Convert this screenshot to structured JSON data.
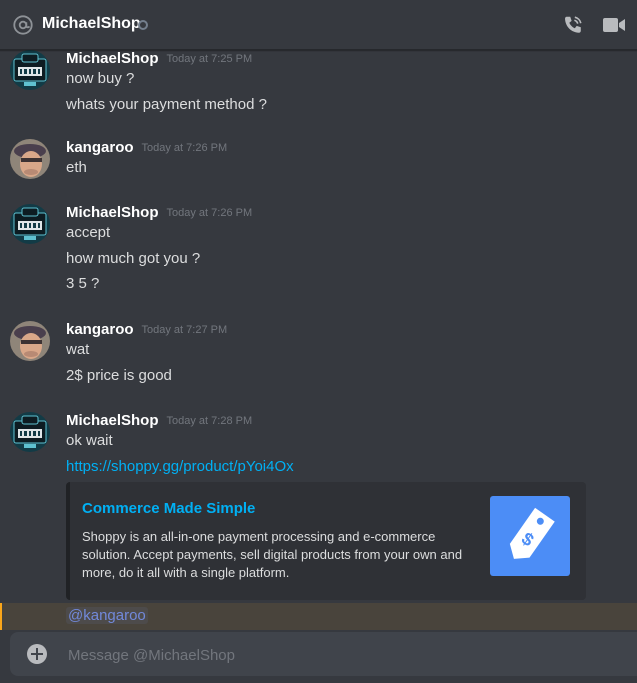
{
  "header": {
    "title": "MichaelShop",
    "at_icon": "at-icon",
    "status": "offline",
    "call_icon": "phone-call-icon",
    "video_icon": "video-camera-icon"
  },
  "colors": {
    "background": "#36393f",
    "link": "#00b0f4",
    "mention": "#7289da",
    "mention_highlight": "#faa61a",
    "embed_thumb": "#4c8df6"
  },
  "messages": [
    {
      "author": "MichaelShop",
      "timestamp": "Today at 7:25 PM",
      "avatar": "michaelshop-avatar",
      "lines": [
        "now buy ?",
        "whats your payment method ?"
      ]
    },
    {
      "author": "kangaroo",
      "timestamp": "Today at 7:26 PM",
      "avatar": "kangaroo-avatar",
      "lines": [
        "eth"
      ]
    },
    {
      "author": "MichaelShop",
      "timestamp": "Today at 7:26 PM",
      "avatar": "michaelshop-avatar",
      "lines": [
        "accept",
        "how much got you ?",
        "3 5 ?"
      ]
    },
    {
      "author": "kangaroo",
      "timestamp": "Today at 7:27 PM",
      "avatar": "kangaroo-avatar",
      "lines": [
        "wat",
        "2$ price is good"
      ]
    },
    {
      "author": "MichaelShop",
      "timestamp": "Today at 7:28 PM",
      "avatar": "michaelshop-avatar",
      "lines": [
        "ok wait"
      ],
      "link": "https://shoppy.gg/product/pYoi4Ox",
      "embed": {
        "title": "Commerce Made Simple",
        "description": "Shoppy is an all-in-one payment processing and e-commerce solution. Accept payments, sell digital products from your own and more, do it all with a single platform.",
        "thumbnail": "shoppy-tag-icon"
      },
      "mention": "@kangaroo"
    }
  ],
  "composer": {
    "placeholder": "Message @MichaelShop",
    "value": "",
    "add_icon": "plus-circle-icon"
  }
}
